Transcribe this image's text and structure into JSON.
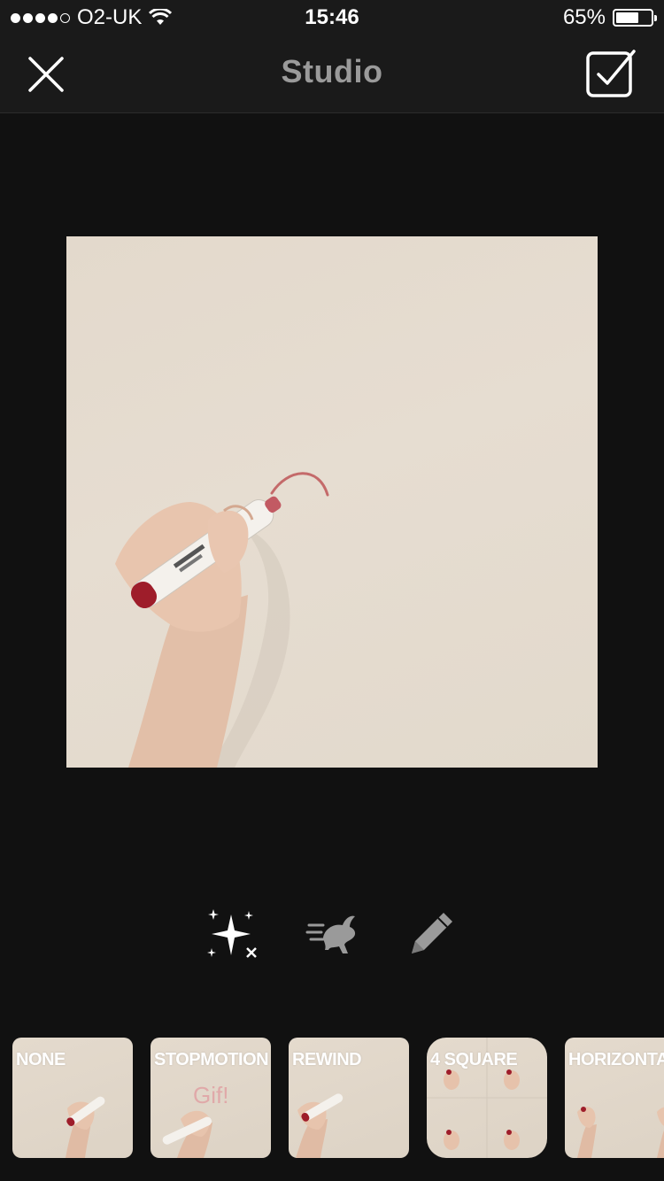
{
  "status_bar": {
    "carrier": "O2-UK",
    "time": "15:46",
    "battery_percent": "65%",
    "battery_level": 0.65,
    "signal_bars_filled": 4,
    "signal_bars_total": 5
  },
  "nav": {
    "title": "Studio",
    "close_icon": "close-icon",
    "done_icon": "checkbox-done-icon"
  },
  "preview": {
    "image_description_icon": "video-preview"
  },
  "tools": [
    {
      "name": "effects",
      "icon": "sparkle-icon"
    },
    {
      "name": "speed",
      "icon": "rabbit-speed-icon"
    },
    {
      "name": "draw",
      "icon": "pencil-icon"
    }
  ],
  "filters": [
    {
      "label": "NONE"
    },
    {
      "label": "STOPMOTION"
    },
    {
      "label": "REWIND"
    },
    {
      "label": "4 SQUARE"
    },
    {
      "label": "HORIZONTAL"
    }
  ],
  "colors": {
    "background": "#111111",
    "nav_background": "#1a1a1a",
    "title_gray": "#9a9a9a",
    "icon_gray": "#9a9a9a"
  }
}
